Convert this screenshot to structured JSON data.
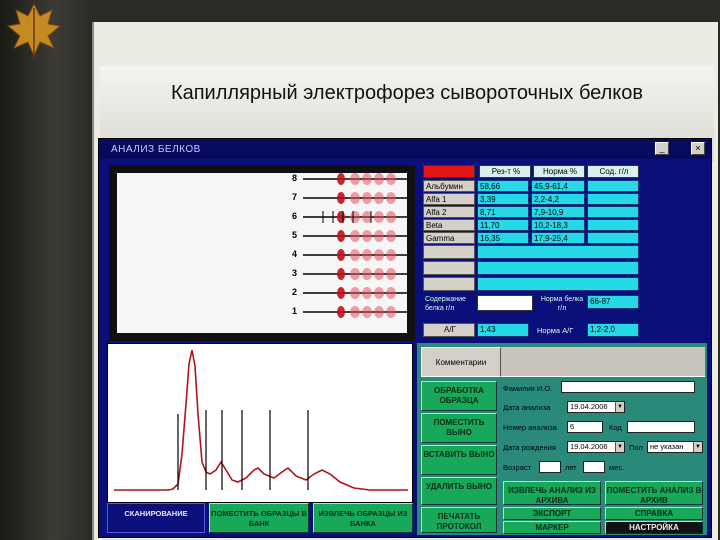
{
  "slide": {
    "title": "Капиллярный электрофорез сывороточных белков"
  },
  "window": {
    "title": "АНАЛИЗ БЕЛКОВ",
    "minimize": "_",
    "close": "×"
  },
  "gel": {
    "lane_labels": [
      "8",
      "7",
      "6",
      "5",
      "4",
      "3",
      "2",
      "1"
    ]
  },
  "table": {
    "headers": {
      "result": "Рез-т %",
      "norm": "Норма %",
      "conc": "Сод. г/л"
    },
    "rows": [
      {
        "name": "Альбумин",
        "result": "58,66",
        "norm": "45,9-61,4"
      },
      {
        "name": "Alfa 1",
        "result": "3,39",
        "norm": "2,2-4,2"
      },
      {
        "name": "Alfa 2",
        "result": "8,71",
        "norm": "7,9-10,9"
      },
      {
        "name": "Beta",
        "result": "11,70",
        "norm": "10,2-18,3"
      },
      {
        "name": "Gamma",
        "result": "16,35",
        "norm": "17,9-25,4"
      }
    ],
    "protein_label": "Содержание белка г/л",
    "protein_norm_label": "Норма белка г/л",
    "protein_norm_value": "66-87",
    "ag_label": "А/Г",
    "ag_value": "1,43",
    "ag_norm_label": "Норма А/Г",
    "ag_norm_value": "1,2-2,0"
  },
  "panel": {
    "tab_label": "Комментарии",
    "buttons": {
      "process": "ОБРАБОТКА ОБРАЗЦА",
      "move": "ПОМЕСТИТЬ ВЫНО",
      "insert": "ВСТАВИТЬ ВЫНО",
      "delete": "УДАЛИТЬ ВЫНО",
      "print": "ПЕЧАТАТЬ ПРОТОКОЛ",
      "extract": "ИЗВЛЕЧЬ АНАЛИЗ ИЗ АРХИВА",
      "archive": "ПОМЕСТИТЬ АНАЛИЗ В АРХИВ",
      "export": "ЭКСПОРТ",
      "help": "СПРАВКА",
      "marker": "МАРКЕР",
      "settings": "НАСТРОЙКА"
    },
    "fields": {
      "name_label": "Фамилия И.О.",
      "date_label": "Дата анализа",
      "date_value": "19.04.2006",
      "number_label": "Номер анализа",
      "number_value": "6",
      "code_label": "Код",
      "birth_label": "Дата рождения",
      "birth_value": "19.04.2006",
      "sex_label": "Пол",
      "sex_value": "не указан",
      "age_label": "Возраст",
      "years_label": "лет",
      "months_label": "мес."
    }
  },
  "bottom": {
    "scan": "СКАНИРОВАНИЕ",
    "to_bank": "ПОМЕСТИТЬ ОБРАЗЦЫ В БАНК",
    "from_bank": "ИЗВЛЕЧЬ ОБРАЗЦЫ ИЗ БАНКА"
  },
  "colors": {
    "window_bg": "#0b0f7a",
    "value_cells": "#26d9e6",
    "buttons": "#17a85a",
    "panel": "#2a8a7a"
  }
}
